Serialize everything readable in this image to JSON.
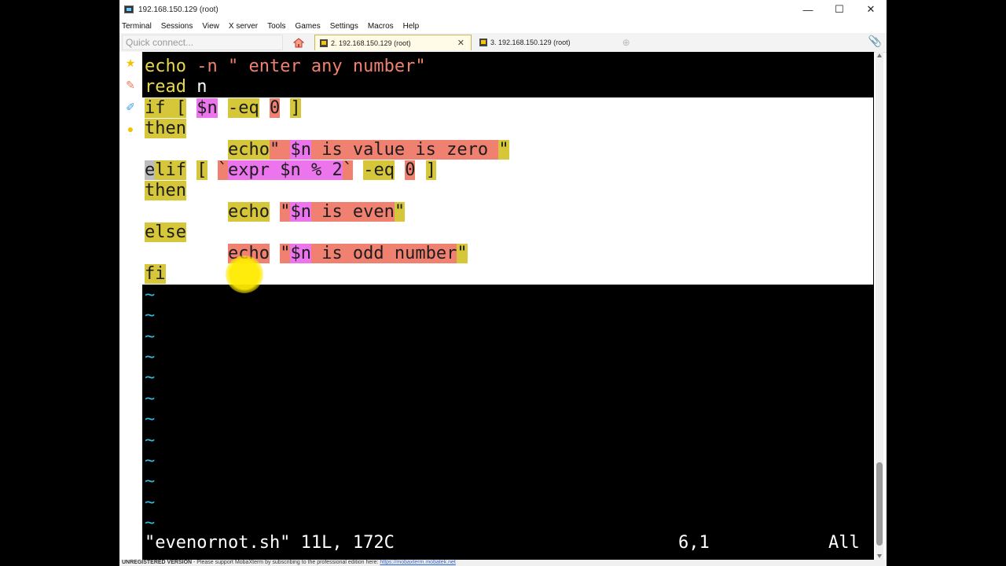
{
  "window": {
    "title": "192.168.150.129 (root)",
    "controls": {
      "minimize": "—",
      "maximize": "☐",
      "close": "✕"
    }
  },
  "menu": [
    "Terminal",
    "Sessions",
    "View",
    "X server",
    "Tools",
    "Games",
    "Settings",
    "Macros",
    "Help"
  ],
  "tabbar": {
    "quick_connect_placeholder": "Quick connect...",
    "tabs": [
      {
        "label": "2. 192.168.150.129 (root)",
        "active": true
      },
      {
        "label": "3. 192.168.150.129 (root)",
        "active": false
      }
    ]
  },
  "editor": {
    "lines_top": {
      "l1_echo": "echo",
      "l1_opt": " -n ",
      "l1_str": "\" enter any number\"",
      "l2_read": "read",
      "l2_var": " n"
    },
    "selected": {
      "if_a": "if [",
      "if_var": "$n",
      "if_eq": "-eq",
      "if_zero": "0",
      "if_close": "]",
      "then1": "then",
      "echo1": "echo",
      "echo1_q": "\" ",
      "echo1_var": "$n",
      "echo1_rest": " is value is zero ",
      "echo1_q2": "\"",
      "elif_e": "e",
      "elif_rest": "lif",
      "elif_br": "[",
      "elif_bt": "`",
      "elif_expr": "expr $n % 2",
      "elif_bt2": "`",
      "elif_eq": "-eq",
      "elif_zero": "0",
      "elif_close": "]",
      "then2": "then",
      "echo2": "echo",
      "echo2_q": "\"",
      "echo2_var": "$n",
      "echo2_rest": " is even",
      "echo2_q2": "\"",
      "else": "else",
      "echo3": "echo",
      "echo3_q": "\"",
      "echo3_var": "$n",
      "echo3_rest": " is odd number",
      "echo3_q2": "\"",
      "fi": "fi"
    },
    "tilde": "~",
    "status_file": "\"evenornot.sh\" 11L, 172C",
    "cursor_pos": "6,1",
    "scroll_pos": "All"
  },
  "footer": {
    "unregistered": "UNREGISTERED VERSION",
    "message": " -  Please support MobaXterm by subscribing to the professional edition here: ",
    "link": "https://mobaxterm.mobatek.net"
  },
  "colors": {
    "keyword": "#d5c63a",
    "string": "#f08070",
    "variable": "#ec74ec",
    "tilde": "#39b6d8"
  }
}
